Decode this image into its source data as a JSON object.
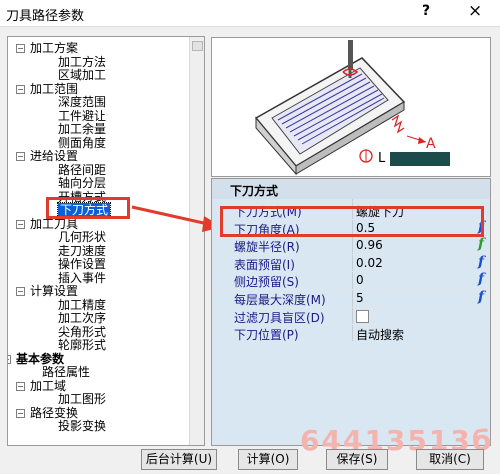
{
  "window": {
    "title": "刀具路径参数",
    "help_label": "?",
    "close_label": "×"
  },
  "tree": [
    {
      "label": "加工方案",
      "indent": 1,
      "expander": "minus"
    },
    {
      "label": "加工方法",
      "indent": 3
    },
    {
      "label": "区域加工",
      "indent": 3
    },
    {
      "label": "加工范围",
      "indent": 1,
      "expander": "minus"
    },
    {
      "label": "深度范围",
      "indent": 3
    },
    {
      "label": "工件避让",
      "indent": 3
    },
    {
      "label": "加工余量",
      "indent": 3
    },
    {
      "label": "侧面角度",
      "indent": 3
    },
    {
      "label": "进给设置",
      "indent": 1,
      "expander": "minus"
    },
    {
      "label": "路径间距",
      "indent": 3
    },
    {
      "label": "轴向分层",
      "indent": 3
    },
    {
      "label": "开槽方式",
      "indent": 3
    },
    {
      "label": "下刀方式",
      "indent": 3,
      "selected": true
    },
    {
      "label": "加工刀具",
      "indent": 1,
      "expander": "minus"
    },
    {
      "label": "几何形状",
      "indent": 3
    },
    {
      "label": "走刀速度",
      "indent": 3
    },
    {
      "label": "操作设置",
      "indent": 3
    },
    {
      "label": "插入事件",
      "indent": 3
    },
    {
      "label": "计算设置",
      "indent": 1,
      "expander": "minus"
    },
    {
      "label": "加工精度",
      "indent": 3
    },
    {
      "label": "加工次序",
      "indent": 3
    },
    {
      "label": "尖角形式",
      "indent": 3
    },
    {
      "label": "轮廓形式",
      "indent": 3
    },
    {
      "label": "基本参数",
      "indent": 0,
      "expander": "minus",
      "bold": true
    },
    {
      "label": "路径属性",
      "indent": 2
    },
    {
      "label": "加工域",
      "indent": 1,
      "expander": "minus"
    },
    {
      "label": "加工图形",
      "indent": 3
    },
    {
      "label": "路径变换",
      "indent": 1,
      "expander": "minus"
    },
    {
      "label": "投影变换",
      "indent": 3
    }
  ],
  "preview": {
    "dimension_label": "A",
    "length_label": "L"
  },
  "properties": {
    "section_title": "下刀方式",
    "rows": [
      {
        "label": "下刀方式(M)",
        "value": "螺旋下刀",
        "fx": false
      },
      {
        "label": "下刀角度(A)",
        "value": "0.5",
        "fx": true,
        "fx_color": "blue"
      },
      {
        "label": "螺旋半径(R)",
        "value": "0.96",
        "fx": true,
        "fx_color": "green"
      },
      {
        "label": "表面预留(I)",
        "value": "0.02",
        "fx": true,
        "fx_color": "blue"
      },
      {
        "label": "侧边预留(S)",
        "value": "0",
        "fx": true,
        "fx_color": "blue"
      },
      {
        "label": "每层最大深度(M)",
        "value": "5",
        "fx": true,
        "fx_color": "blue"
      },
      {
        "label": "过滤刀具盲区(D)",
        "value": "",
        "fx": false,
        "checkbox": true
      },
      {
        "label": "下刀位置(P)",
        "value": "自动搜索",
        "fx": false
      }
    ],
    "fx_symbol": "f"
  },
  "buttons": {
    "background_compute": "后台计算(U)",
    "compute": "计算(O)",
    "save": "保存(S)",
    "cancel": "取消(C)"
  },
  "watermark": "64413513б",
  "colors": {
    "highlight": "#e23b2c",
    "selection": "#0a60d8",
    "property_bg": "#d9e7f3"
  }
}
